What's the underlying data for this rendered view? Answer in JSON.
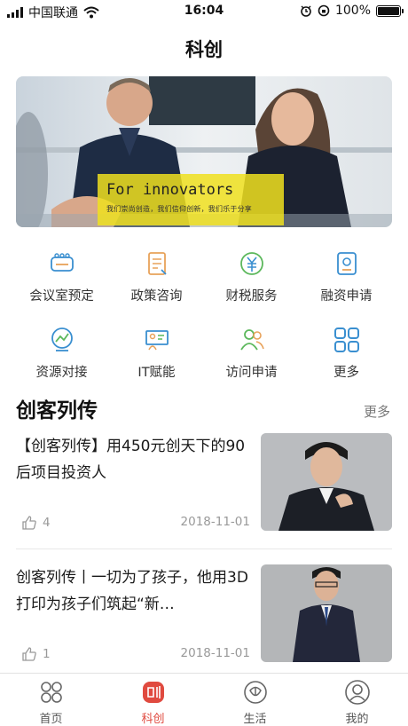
{
  "status_bar": {
    "carrier": "中国联通",
    "time": "16:04",
    "battery": "100%"
  },
  "nav": {
    "title": "科创"
  },
  "banner": {
    "title": "For innovators",
    "subtitle": "我们崇尚创造，我们信仰创新，我们乐于分享"
  },
  "services": [
    {
      "label": "会议室预定",
      "icon": "meeting-room-icon"
    },
    {
      "label": "政策咨询",
      "icon": "policy-document-icon"
    },
    {
      "label": "财税服务",
      "icon": "yuan-coin-icon"
    },
    {
      "label": "融资申请",
      "icon": "finance-application-icon"
    },
    {
      "label": "资源对接",
      "icon": "resource-chart-icon"
    },
    {
      "label": "IT赋能",
      "icon": "it-presentation-icon"
    },
    {
      "label": "访问申请",
      "icon": "visitor-people-icon"
    },
    {
      "label": "更多",
      "icon": "more-grid-icon"
    }
  ],
  "section": {
    "title": "创客列传",
    "more": "更多"
  },
  "articles": [
    {
      "title": "【创客列传】用450元创天下的90后项目投资人",
      "likes": "4",
      "date": "2018-11-01"
    },
    {
      "title": "创客列传丨一切为了孩子，他用3D打印为孩子们筑起“新…",
      "likes": "1",
      "date": "2018-11-01"
    }
  ],
  "tab_bar": {
    "active": "科创",
    "items": [
      {
        "label": "首页",
        "icon": "home-grid-icon"
      },
      {
        "label": "科创",
        "icon": "innovation-icon"
      },
      {
        "label": "生活",
        "icon": "life-icon"
      },
      {
        "label": "我的",
        "icon": "profile-icon"
      }
    ]
  },
  "colors": {
    "accent": "#e04a3f",
    "icon_blue": "#3a8fd0",
    "icon_orange": "#e8a25a",
    "icon_green": "#5cb85c",
    "banner_yellow": "#f0e11e"
  }
}
